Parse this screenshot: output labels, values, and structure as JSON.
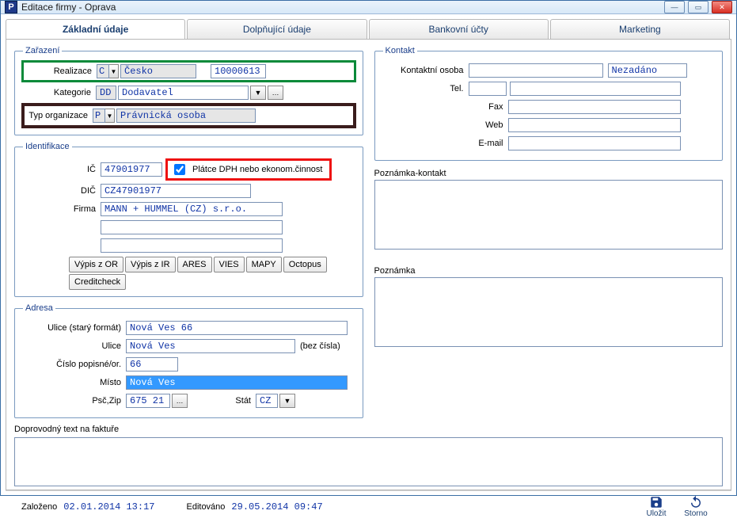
{
  "window": {
    "title": "Editace firmy - Oprava",
    "icon_letter": "P"
  },
  "tabs": [
    "Základní údaje",
    "Dolpňující údaje",
    "Bankovní účty",
    "Marketing"
  ],
  "zarazeni": {
    "legend": "Zařazení",
    "realizace_lbl": "Realizace",
    "realizace_code": "C",
    "realizace_name": "Česko",
    "realizace_num": "10000613",
    "kategorie_lbl": "Kategorie",
    "kategorie_code": "DD",
    "kategorie_name": "Dodavatel",
    "typorg_lbl": "Typ organizace",
    "typorg_code": "P",
    "typorg_name": "Právnická osoba"
  },
  "ident": {
    "legend": "Identifikace",
    "ic_lbl": "IČ",
    "ic": "47901977",
    "platce_lbl": "Plátce DPH nebo ekonom.činnost",
    "dic_lbl": "DIČ",
    "dic": "CZ47901977",
    "firma_lbl": "Firma",
    "firma": "MANN + HUMMEL (CZ) s.r.o.",
    "buttons": [
      "Výpis z OR",
      "Výpis z IR",
      "ARES",
      "VIES",
      "MAPY",
      "Octopus",
      "Creditcheck"
    ]
  },
  "adresa": {
    "legend": "Adresa",
    "uliceold_lbl": "Ulice (starý formát)",
    "uliceold": "Nová Ves 66",
    "ulice_lbl": "Ulice",
    "ulice": "Nová Ves",
    "bezcisla": "(bez čísla)",
    "cp_lbl": "Číslo popisné/or.",
    "cp": "66",
    "misto_lbl": "Místo",
    "misto": "Nová Ves",
    "psc_lbl": "Psč,Zip",
    "psc": "675 21",
    "stat_lbl": "Stát",
    "stat": "CZ"
  },
  "faktura_lbl": "Doprovodný text na faktuře",
  "kontakt": {
    "legend": "Kontakt",
    "osoba_lbl": "Kontaktní osoba",
    "nezadano": "Nezadáno",
    "tel_lbl": "Tel.",
    "fax_lbl": "Fax",
    "web_lbl": "Web",
    "email_lbl": "E-mail"
  },
  "pozn_kontakt_lbl": "Poznámka-kontakt",
  "pozn_lbl": "Poznámka",
  "footer": {
    "zalozeno_lbl": "Založeno",
    "zalozeno": "02.01.2014 13:17",
    "edit_lbl": "Editováno",
    "edit": "29.05.2014 09:47",
    "ulozit": "Uložit",
    "storno": "Storno"
  }
}
